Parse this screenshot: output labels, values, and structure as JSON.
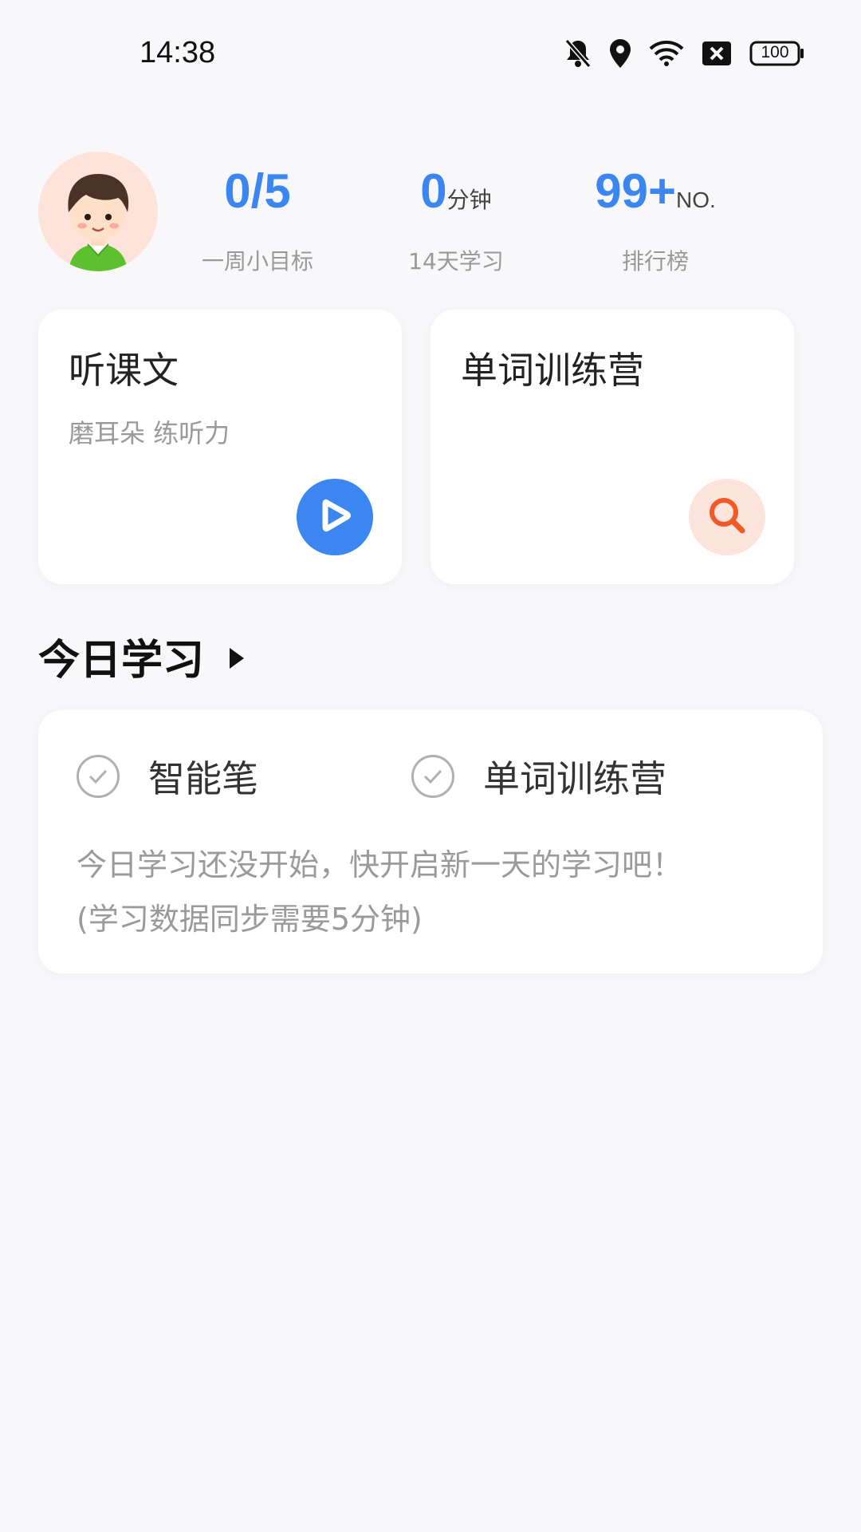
{
  "status_bar": {
    "time": "14:38",
    "battery": "100",
    "icons": [
      "bell-off-icon",
      "location-icon",
      "wifi-icon",
      "sim-x-icon",
      "battery-icon"
    ]
  },
  "stats": [
    {
      "value": "0/5",
      "unit": "",
      "label": "一周小目标"
    },
    {
      "value": "0",
      "unit": "分钟",
      "label": "14天学习"
    },
    {
      "value": "99+",
      "unit": "NO.",
      "label": "排行榜"
    }
  ],
  "cards": {
    "listen": {
      "title": "听课文",
      "subtitle": "磨耳朵 练听力",
      "icon": "play-icon",
      "color": "#3b86f0"
    },
    "words": {
      "title": "单词训练营",
      "icon": "search-icon",
      "color": "#f05a28"
    }
  },
  "today": {
    "title": "今日学习",
    "tasks": [
      "智能笔",
      "单词训练营"
    ],
    "message_line1": "今日学习还没开始，快开启新一天的学习吧！",
    "message_line2": "(学习数据同步需要5分钟)"
  }
}
